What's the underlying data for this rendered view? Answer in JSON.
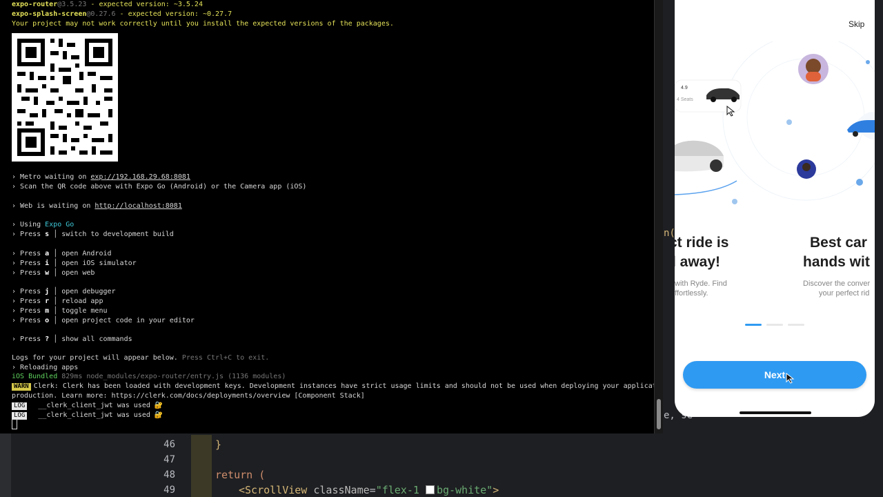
{
  "terminal": {
    "warn_lines": [
      {
        "pkg": "expo-router",
        "installed": "@3.5.23",
        "rest": " - expected version: ~3.5.24"
      },
      {
        "pkg": "expo-splash-screen",
        "installed": "@0.27.6",
        "rest": " - expected version: ~0.27.7"
      }
    ],
    "warn_tail": "Your project may not work correctly until you install the expected versions of the packages.",
    "metro_prefix": "› Metro waiting on ",
    "metro_url": "exp://192.168.29.68:8081",
    "scan_line": "› Scan the QR code above with Expo Go (Android) or the Camera app (iOS)",
    "web_prefix": "› Web is waiting on ",
    "web_url": "http://localhost:8081",
    "using_prefix": "› Using ",
    "using_value": "Expo Go",
    "press_lines": [
      {
        "key": "s",
        "desc": "switch to development build"
      },
      {
        "key": "a",
        "desc": "open Android"
      },
      {
        "key": "i",
        "desc": "open iOS simulator"
      },
      {
        "key": "w",
        "desc": "open web"
      },
      {
        "key": "j",
        "desc": "open debugger"
      },
      {
        "key": "r",
        "desc": "reload app"
      },
      {
        "key": "m",
        "desc": "toggle menu"
      },
      {
        "key": "o",
        "desc": "open project code in your editor"
      },
      {
        "key": "?",
        "desc": "show all commands"
      }
    ],
    "logs_line": "Logs for your project will appear below.",
    "logs_hint": " Press Ctrl+C to exit.",
    "reloading": "› Reloading apps",
    "bundled_prefix": "iOS Bundled",
    "bundled_detail": " 829ms node_modules/expo-router/entry.js (1136 modules)",
    "warn_badge": "WARN",
    "warn_msg": "Clerk: Clerk has been loaded with development keys. Development instances have strict usage limits and should not be used when deploying your application to",
    "warn_msg2": "production. Learn more: https://clerk.com/docs/deployments/overview [Component Stack]",
    "log_badge": "LOG",
    "log_msg": "  __clerk_client_jwt was used 🔐"
  },
  "editor": {
    "lines": [
      {
        "num": "46",
        "code": "}"
      },
      {
        "num": "47",
        "code": ""
      },
      {
        "num": "48",
        "code": "return ("
      },
      {
        "num": "49",
        "code": "<ScrollView className=\"flex-1 bg-white\">"
      }
    ],
    "frag_paren": "n(",
    "frag_se": "e, se"
  },
  "phone": {
    "skip_label": "Skip",
    "rating": "4.9",
    "seats": "4 Seats",
    "slide1_title_l1": "ct ride is",
    "slide1_title_l2": "l away!",
    "slide1_sub_l1": "with Ryde. Find",
    "slide1_sub_l2": "effortlessly.",
    "slide2_title_l1": "Best car",
    "slide2_title_l2": "hands wit",
    "slide2_sub_l1": "Discover the conver",
    "slide2_sub_l2": "your perfect rid",
    "next_label": "Next",
    "accent": "#2f9af2"
  }
}
